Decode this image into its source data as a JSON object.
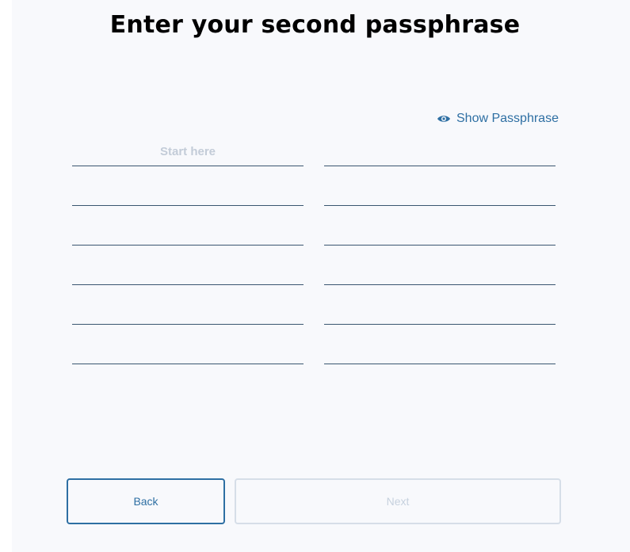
{
  "page": {
    "title": "Enter your second passphrase"
  },
  "toggle": {
    "label": "Show Passphrase",
    "icon": "eye-icon"
  },
  "words": {
    "placeholder_first": "Start here",
    "fields": [
      "",
      "",
      "",
      "",
      "",
      "",
      "",
      "",
      "",
      "",
      "",
      ""
    ]
  },
  "actions": {
    "back_label": "Back",
    "next_label": "Next",
    "next_enabled": false
  },
  "colors": {
    "accent": "#2e6fa3",
    "disabled": "#c6d1de",
    "background": "#f8f9fc",
    "line": "#3a5670"
  }
}
